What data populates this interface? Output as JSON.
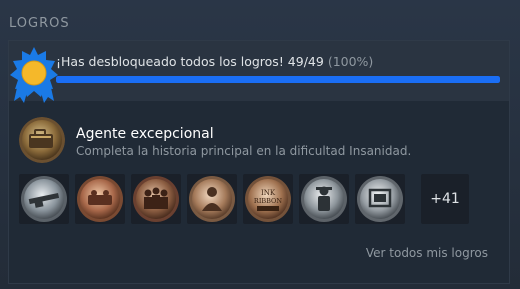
{
  "section": {
    "title": "LOGROS"
  },
  "progress": {
    "text": "¡Has desbloqueado todos los logros! 49/49",
    "percent_label": "(100%)",
    "fraction": 1.0
  },
  "featured": {
    "title": "Agente excepcional",
    "description": "Completa la historia principal en la dificultad Insanidad.",
    "icon": "briefcase-medal-icon"
  },
  "achievements": [
    {
      "icon": "rifle-medal-icon"
    },
    {
      "icon": "bronze-relief-medal-icon"
    },
    {
      "icon": "group-figures-medal-icon"
    },
    {
      "icon": "portrait-medal-icon"
    },
    {
      "icon": "ink-ribbon-medal-icon",
      "text": "INK\nRIBBON"
    },
    {
      "icon": "soldier-medal-icon"
    },
    {
      "icon": "framed-picture-medal-icon"
    }
  ],
  "more": {
    "label": "+41"
  },
  "footer": {
    "view_all_label": "Ver todos mis logros"
  },
  "colors": {
    "accent_blue": "#1a6ef5",
    "badge_blue": "#1a7ae6",
    "badge_gold": "#f5b82a"
  }
}
